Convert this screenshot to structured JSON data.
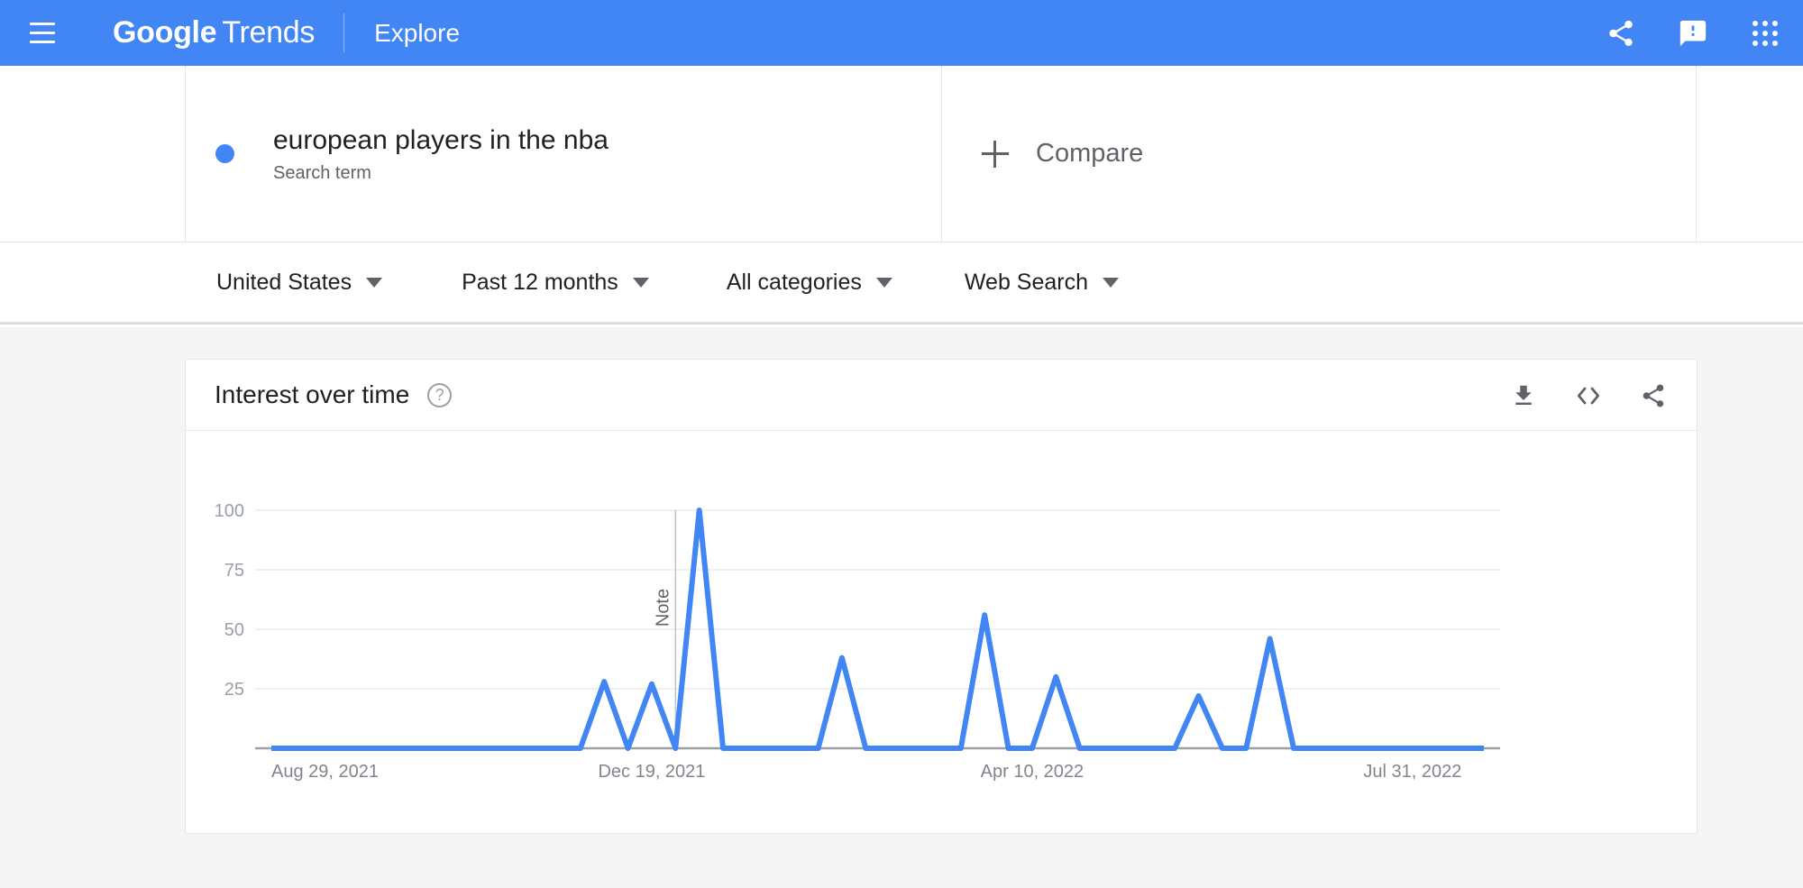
{
  "header": {
    "menu_icon": "hamburger-icon",
    "brand_bold": "Google",
    "brand_light": "Trends",
    "explore_label": "Explore",
    "share_icon": "share-icon",
    "feedback_icon": "feedback-icon",
    "apps_icon": "apps-grid-icon",
    "bar_color": "#4285F4"
  },
  "search_row": {
    "term": "european players in the nba",
    "term_type": "Search term",
    "dot_color": "#4285F4",
    "compare_label": "Compare",
    "compare_icon": "plus-icon"
  },
  "filters": [
    {
      "label": "United States",
      "name": "location-filter"
    },
    {
      "label": "Past 12 months",
      "name": "time-range-filter"
    },
    {
      "label": "All categories",
      "name": "category-filter"
    },
    {
      "label": "Web Search",
      "name": "search-type-filter"
    }
  ],
  "card": {
    "title": "Interest over time",
    "help_icon": "question-mark-icon",
    "download_icon": "download-icon",
    "embed_icon": "embed-code-icon",
    "share_icon": "share-icon"
  },
  "chart_data": {
    "type": "line",
    "title": "Interest over time",
    "xlabel": "",
    "ylabel": "",
    "ylim": [
      0,
      100
    ],
    "yticks": [
      25,
      50,
      75,
      100
    ],
    "grid": true,
    "legend": "none",
    "line_color": "#4285F4",
    "axis_color": "#9aa0a6",
    "xtick_labels": [
      "Aug 29, 2021",
      "Dec 19, 2021",
      "Apr 10, 2022",
      "Jul 31, 2022"
    ],
    "xtick_positions": [
      0,
      16,
      32,
      48
    ],
    "annotation": {
      "label": "Note",
      "index": 17
    },
    "series": [
      {
        "name": "european players in the nba",
        "values": [
          0,
          0,
          0,
          0,
          0,
          0,
          0,
          0,
          0,
          0,
          0,
          0,
          0,
          0,
          28,
          0,
          27,
          0,
          100,
          0,
          0,
          0,
          0,
          0,
          38,
          0,
          0,
          0,
          0,
          0,
          56,
          0,
          0,
          30,
          0,
          0,
          0,
          0,
          0,
          22,
          0,
          0,
          46,
          0,
          0,
          0,
          0,
          0,
          0,
          0,
          0,
          0
        ]
      }
    ]
  }
}
